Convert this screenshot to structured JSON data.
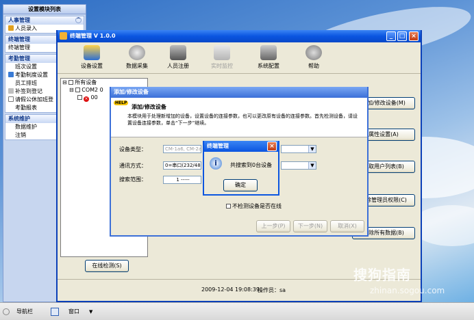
{
  "nav": {
    "title": "设置模块列表",
    "groups": [
      {
        "title": "人事管理",
        "items": [
          "人员录入"
        ]
      },
      {
        "title": "终端管理",
        "items": [
          "终端管理"
        ]
      },
      {
        "title": "考勤管理",
        "items": [
          "班次设置",
          "考勤制度设置",
          "员工排班",
          "补签到登记",
          "请假公休加班登",
          "考勤报表"
        ]
      },
      {
        "title": "系统维护",
        "items": [
          "数据维护",
          "注销"
        ]
      }
    ]
  },
  "window": {
    "title": "终端管理 V 1.0.0",
    "toolbar": [
      "设备设置",
      "数据采集",
      "人员注册",
      "实时监控",
      "系统配置",
      "帮助"
    ],
    "tree": {
      "root": "所有设备",
      "child1": "COM2 0",
      "child2": "00"
    },
    "online_check": "在线检测(S)",
    "side_buttons": [
      "添加/修改设备(M)",
      "属性设置(A)",
      "获取用户列表(B)",
      "清除管理员权限(C)",
      "清除所有数据(B)"
    ],
    "status": {
      "datetime": "2009-12-04 19:08:39",
      "operator_label": "操作员：",
      "operator": "sa"
    }
  },
  "dialog": {
    "title": "添加/修改设备",
    "heading": "添加/修改设备",
    "help_badge": "HELP",
    "desc": "本模块用于处理新增加的设备，设置设备的连接参数，也可以更改原有设备的连接参数。首先检测设备，请设置设备连接参数，单击“下一步”继续。",
    "device_type_label": "设备类型：",
    "device_type_value": "CM-1a6, CM-2a6,",
    "comm_label": "通讯方式：",
    "comm_value": "0=串口(232/485",
    "range_label": "搜索范围：",
    "range_from": "1",
    "range_sep": "-----",
    "no_detect_label": "不检测设备是否在线",
    "buttons": {
      "prev": "上一步(P)",
      "next": "下一步(N)",
      "cancel": "取消(X)"
    }
  },
  "msgbox": {
    "title": "终端管理",
    "text": "共搜索到0台设备",
    "ok": "确定"
  },
  "taskbar": {
    "nav": "导航栏",
    "window": "窗口"
  },
  "watermark": {
    "brand": "搜狗指南",
    "url": "zhinan.sogou.com"
  },
  "colors": {
    "title_blue": "#0a55e0",
    "dialog_blue": "#3b6fd8",
    "nav_bg": "#c7d6ef"
  }
}
